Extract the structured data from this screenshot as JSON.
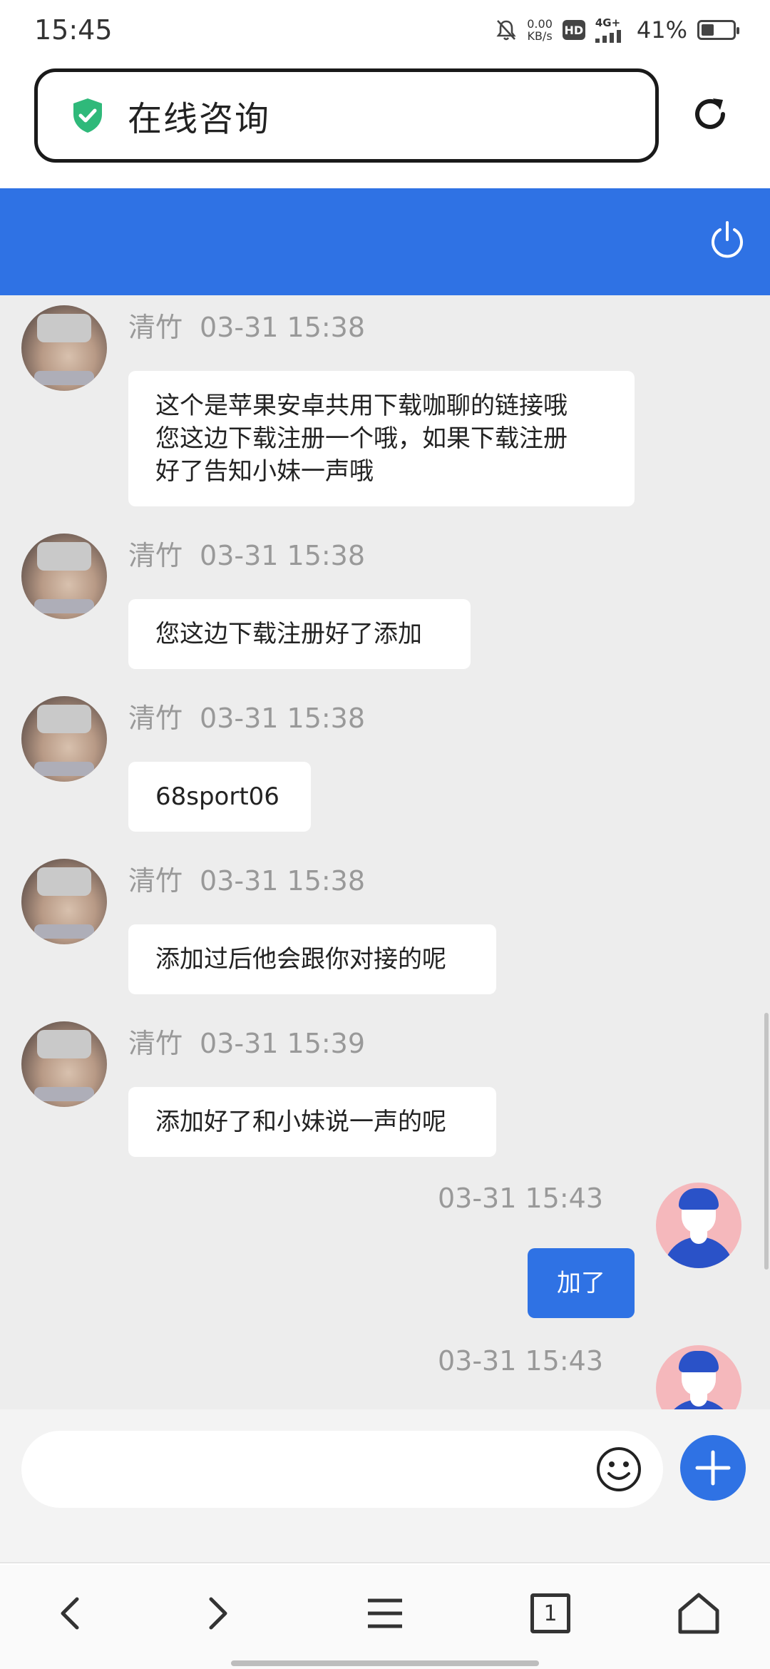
{
  "status_bar": {
    "time": "15:45",
    "net_speed_value": "0.00",
    "net_speed_unit": "KB/s",
    "hd_badge": "HD",
    "network_type": "4G+",
    "battery_percent": "41%",
    "battery_level": 0.41
  },
  "browser": {
    "address_title": "在线咨询",
    "secure_icon": "shield-check-icon",
    "reload_icon": "reload-icon"
  },
  "chat_header": {
    "power_icon": "power-icon",
    "color": "#2f72e4"
  },
  "messages": [
    {
      "sender": "清竹",
      "time": "03-31 15:38",
      "lines": [
        "这个是苹果安卓共用下载咖聊的链接哦",
        "您这边下载注册一个哦，如果下载注册",
        "好了告知小妹一声哦"
      ],
      "direction": "incoming"
    },
    {
      "sender": "清竹",
      "time": "03-31 15:38",
      "lines": [
        "您这边下载注册好了添加"
      ],
      "direction": "incoming"
    },
    {
      "sender": "清竹",
      "time": "03-31 15:38",
      "lines": [
        "68sport06"
      ],
      "direction": "incoming"
    },
    {
      "sender": "清竹",
      "time": "03-31 15:38",
      "lines": [
        "添加过后他会跟你对接的呢"
      ],
      "direction": "incoming"
    },
    {
      "sender": "清竹",
      "time": "03-31 15:39",
      "lines": [
        "添加好了和小妹说一声的呢"
      ],
      "direction": "incoming"
    },
    {
      "sender": "",
      "time": "03-31 15:43",
      "lines": [
        "加了"
      ],
      "direction": "outgoing"
    },
    {
      "sender": "",
      "time": "03-31 15:43",
      "lines": [],
      "direction": "outgoing"
    }
  ],
  "input_bar": {
    "placeholder": "",
    "emoji_icon": "emoji-icon",
    "plus_icon": "plus-icon"
  },
  "bottom_nav": {
    "back_icon": "chevron-left-icon",
    "forward_icon": "chevron-right-icon",
    "menu_icon": "menu-icon",
    "tab_count": "1",
    "home_icon": "home-icon"
  },
  "colors": {
    "accent": "#2f72e4",
    "chat_background": "#ededed",
    "bubble_incoming": "#ffffff",
    "secure_green": "#2fb97a"
  }
}
